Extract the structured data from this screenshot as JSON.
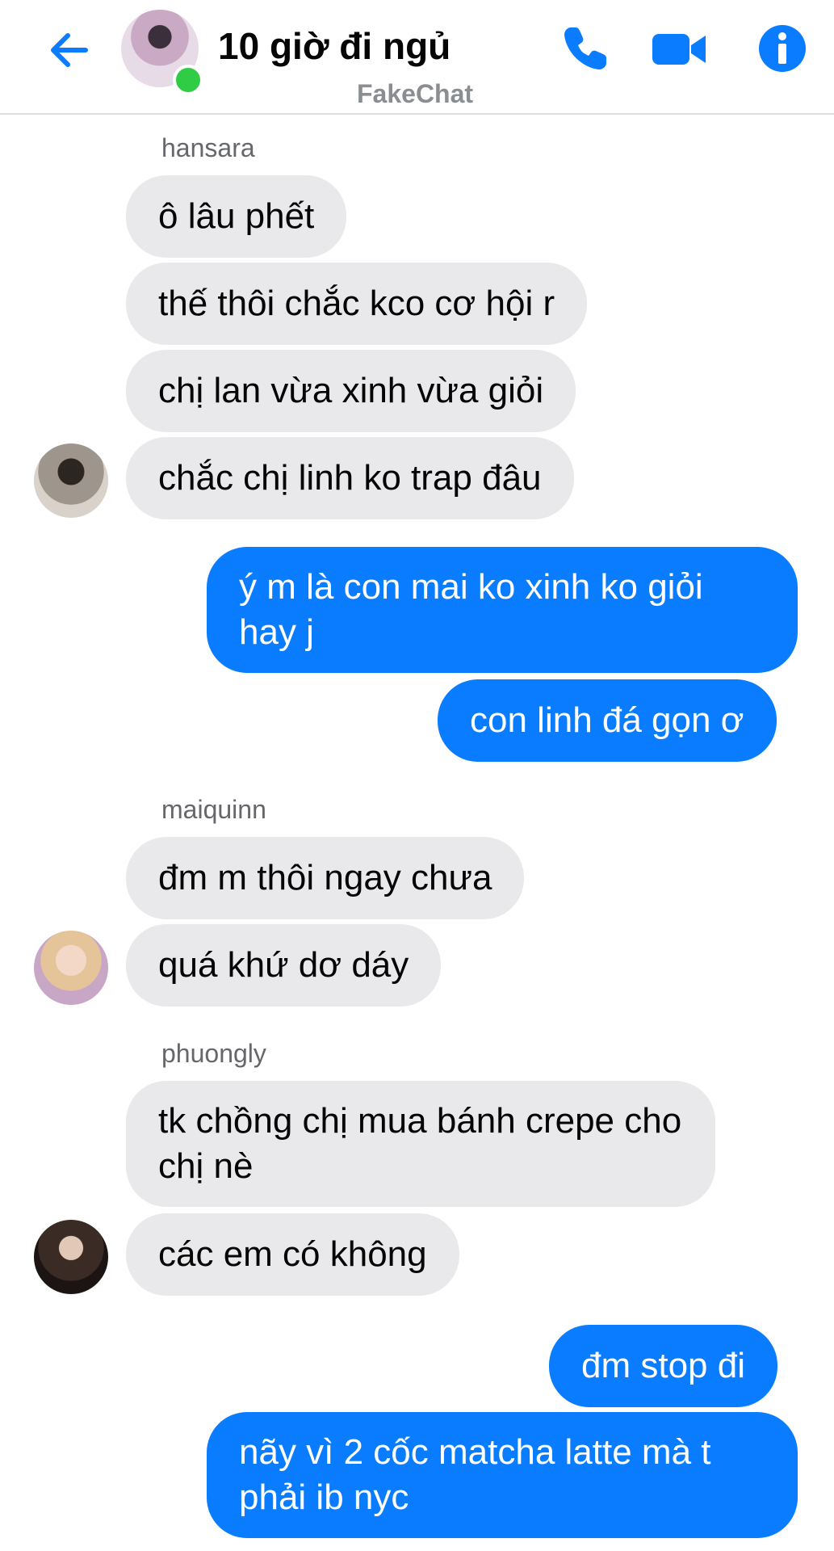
{
  "header": {
    "title": "10 giờ đi ngủ",
    "subtitle": "FakeChat",
    "accent_color": "#0a7cff",
    "icons": [
      "back-arrow-icon",
      "phone-icon",
      "video-camera-icon",
      "info-icon"
    ]
  },
  "messages": {
    "group1_sender": "hansara",
    "m1": "ô lâu phết",
    "m2": "thế thôi chắc kco cơ hội r",
    "m3": "chị lan vừa xinh vừa giỏi",
    "m4": "chắc chị linh ko trap đâu",
    "m5": "ý m là con mai ko xinh ko giỏi hay j",
    "m6": "con linh đá gọn ơ",
    "group2_sender": "maiquinn",
    "m7": "đm m thôi ngay chưa",
    "m8": "quá khứ dơ dáy",
    "group3_sender": "phuongly",
    "m9": "tk chồng chị mua bánh crepe cho chị nè",
    "m10": "các em có không",
    "m11": "đm stop đi",
    "m12": "nãy vì 2 cốc matcha latte mà t phải ib nyc"
  },
  "colors": {
    "incoming_bubble": "#e9e9eb",
    "outgoing_bubble": "#0a7cff",
    "online": "#31cc46"
  }
}
